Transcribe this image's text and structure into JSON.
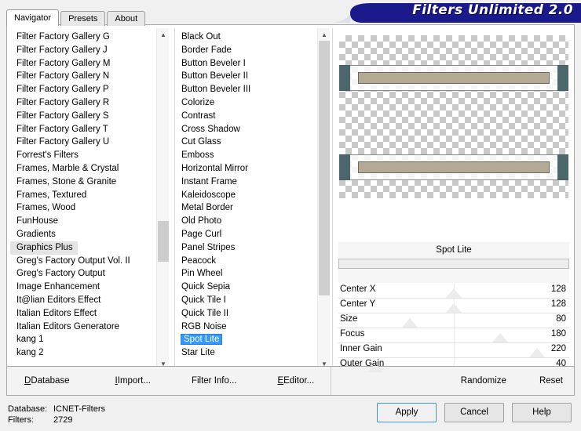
{
  "app": {
    "banner_title": "Filters Unlimited 2.0"
  },
  "tabs": [
    {
      "label": "Navigator",
      "active": true
    },
    {
      "label": "Presets",
      "active": false
    },
    {
      "label": "About",
      "active": false
    }
  ],
  "category_list": {
    "items": [
      "Filter Factory Gallery G",
      "Filter Factory Gallery J",
      "Filter Factory Gallery M",
      "Filter Factory Gallery N",
      "Filter Factory Gallery P",
      "Filter Factory Gallery R",
      "Filter Factory Gallery S",
      "Filter Factory Gallery T",
      "Filter Factory Gallery U",
      "Forrest's Filters",
      "Frames, Marble & Crystal",
      "Frames, Stone & Granite",
      "Frames, Textured",
      "Frames, Wood",
      "FunHouse",
      "Gradients",
      "Graphics Plus",
      "Greg's Factory Output Vol. II",
      "Greg's Factory Output",
      "Image Enhancement",
      "It@lian Editors Effect",
      "Italian Editors Effect",
      "Italian Editors Generatore",
      "kang 1",
      "kang 2"
    ],
    "selected": "Graphics Plus",
    "scrollbar": {
      "up_icon": "chevron-up-icon",
      "down_icon": "chevron-down-icon"
    }
  },
  "filter_list": {
    "items": [
      "Black Out",
      "Border Fade",
      "Button Beveler I",
      "Button Beveler II",
      "Button Beveler III",
      "Colorize",
      "Contrast",
      "Cross Shadow",
      "Cut Glass",
      "Emboss",
      "Horizontal Mirror",
      "Instant Frame",
      "Kaleidoscope",
      "Metal Border",
      "Old Photo",
      "Page Curl",
      "Panel Stripes",
      "Peacock",
      "Pin Wheel",
      "Quick Sepia",
      "Quick Tile I",
      "Quick Tile II",
      "RGB Noise",
      "Spot Lite",
      "Star Lite"
    ],
    "selected": "Spot Lite",
    "scrollbar": {
      "up_icon": "chevron-up-icon",
      "down_icon": "chevron-down-icon"
    }
  },
  "parameters": {
    "title": "Spot Lite",
    "rows": [
      {
        "label": "Center X",
        "value": "128",
        "pos": 50
      },
      {
        "label": "Center Y",
        "value": "128",
        "pos": 50
      },
      {
        "label": "Size",
        "value": "80",
        "pos": 31
      },
      {
        "label": "Focus",
        "value": "180",
        "pos": 70
      },
      {
        "label": "Inner Gain",
        "value": "220",
        "pos": 86
      },
      {
        "label": "Outer Gain",
        "value": "40",
        "pos": 16
      }
    ]
  },
  "actionbar": {
    "left": [
      {
        "label": "Database",
        "accel": "D"
      },
      {
        "label": "Import...",
        "accel": "I"
      },
      {
        "label": "Filter Info...",
        "accel": "I"
      },
      {
        "label": "Editor...",
        "accel": "E"
      }
    ],
    "right": [
      {
        "label": "Randomize"
      },
      {
        "label": "Reset"
      }
    ]
  },
  "status": {
    "database_key": "Database:",
    "database_value": "ICNET-Filters",
    "filters_key": "Filters:",
    "filters_value": "2729"
  },
  "dialog_buttons": [
    {
      "label": "Apply",
      "default": true
    },
    {
      "label": "Cancel",
      "default": false
    },
    {
      "label": "Help",
      "default": false
    }
  ],
  "colors": {
    "banner": "#1a1a8c",
    "selection_blue": "#3399ff",
    "selection_soft": "#e4e4e4",
    "preview_bar": "#b3a994",
    "preview_cap": "#3d5a5e"
  }
}
